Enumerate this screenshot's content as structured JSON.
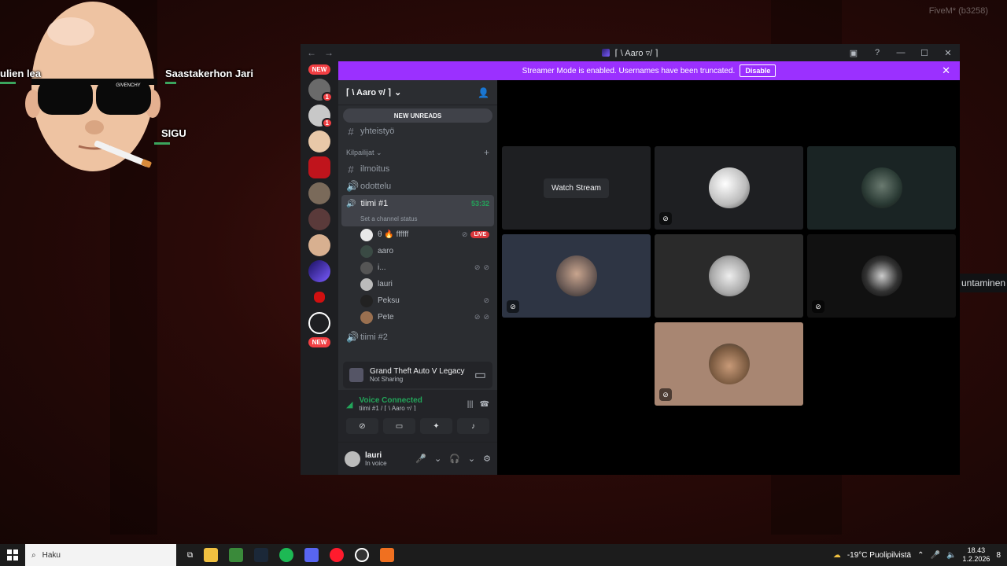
{
  "overlay": {
    "names": [
      "ulien lea",
      "Saastakerhon Jari",
      "SIGU"
    ],
    "sunglasses_brand": "GIVENCHY",
    "watermark": "FiveM* (b3258)",
    "tooltip": "untaminen"
  },
  "window": {
    "title": "⌈ \\ Aaro ▿/ ⌉",
    "controls": [
      "inbox-icon",
      "help-icon",
      "minimize",
      "maximize",
      "close"
    ]
  },
  "banner": {
    "text": "Streamer Mode is enabled. Usernames have been truncated.",
    "disable_label": "Disable"
  },
  "rail": {
    "new_top": "NEW",
    "new_bottom": "NEW",
    "badges": [
      "1",
      "1"
    ]
  },
  "sidebar": {
    "guild_name": "⌈ \\ Aaro ▿/ ⌉",
    "new_unreads": "NEW UNREADS",
    "channels": {
      "yhteistyo": "yhteistyö",
      "category": "Kilpailijat",
      "ilmoitus": "ilmoitus",
      "odottelu": "odottelu",
      "tiimi1": "tiimi #1",
      "tiimi1_timer": "53:32",
      "tiimi1_status": "Set a channel status",
      "tiimi2": "tiimi #2"
    },
    "members": [
      {
        "name": "θ 🔥 ffffff",
        "live": "LIVE"
      },
      {
        "name": "aaro"
      },
      {
        "name": "i..."
      },
      {
        "name": "lauri"
      },
      {
        "name": "Peksu"
      },
      {
        "name": "Pete"
      }
    ],
    "activity": {
      "game": "Grand Theft Auto V Legacy",
      "status": "Not Sharing"
    },
    "voice": {
      "status": "Voice Connected",
      "location": "tiimi #1 / ⌈ \\ Aaro ▿/ ⌉"
    },
    "user": {
      "name": "lauri",
      "status": "In voice"
    }
  },
  "stage": {
    "watch_stream": "Watch Stream"
  },
  "taskbar": {
    "search_placeholder": "Haku",
    "weather": "-19°C  Puolipilvistä",
    "time": "18.43",
    "date": "1.2.2026",
    "notifications": "8"
  },
  "colors": {
    "accent": "#9b30ff",
    "voice_green": "#23a55a",
    "live_red": "#da373c"
  }
}
